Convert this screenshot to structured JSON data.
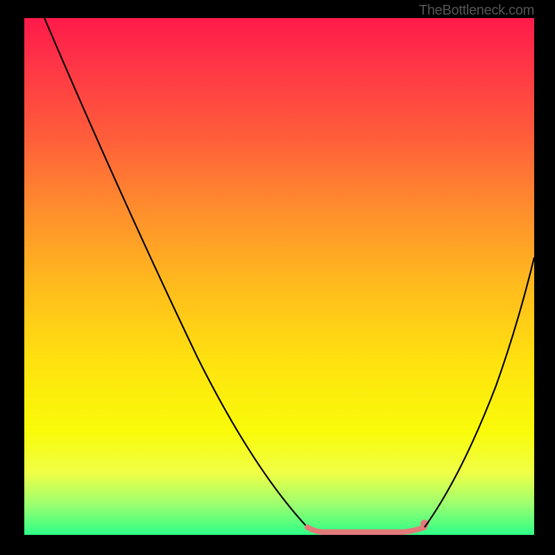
{
  "watermark": "TheBottleneck.com",
  "chart_data": {
    "type": "line",
    "title": "",
    "xlabel": "",
    "ylabel": "",
    "xlim": [
      0,
      100
    ],
    "ylim": [
      0,
      100
    ],
    "grid": false,
    "background": "rainbow-vertical-gradient",
    "description": "V-shaped bottleneck curve: two black curves descending to a flat green-zone minimum, with a pink flat segment and dot near the trough.",
    "series": [
      {
        "name": "left-curve",
        "color": "#000000",
        "x": [
          4,
          10,
          16,
          22,
          28,
          34,
          40,
          46,
          51,
          55.5
        ],
        "y": [
          100,
          86,
          72,
          58,
          45,
          33,
          22,
          13,
          6,
          1.5
        ]
      },
      {
        "name": "flat-segment",
        "color": "#e27a7a",
        "x": [
          55.5,
          58,
          61,
          64,
          67,
          70,
          73,
          76,
          78.5
        ],
        "y": [
          1.5,
          0.6,
          0.4,
          0.4,
          0.4,
          0.4,
          0.5,
          0.8,
          1.5
        ]
      },
      {
        "name": "right-curve",
        "color": "#000000",
        "x": [
          78.5,
          82,
          86,
          90,
          94,
          98,
          100
        ],
        "y": [
          1.5,
          7,
          15,
          25,
          36,
          48,
          54
        ]
      }
    ],
    "marker": {
      "name": "highlight-dot",
      "color": "#e27a7a",
      "x": 78.5,
      "y": 2.2,
      "radius": 4
    }
  }
}
